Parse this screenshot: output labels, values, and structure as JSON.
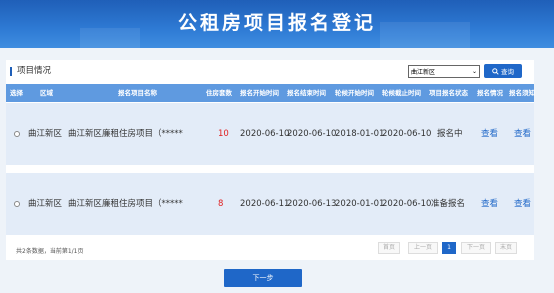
{
  "header": {
    "title": "公租房项目报名登记"
  },
  "section": {
    "title": "项目情况"
  },
  "filter": {
    "district": "曲江新区",
    "search_label": "查询"
  },
  "table": {
    "columns": [
      "选择",
      "区域",
      "报名项目名称",
      "住房套数",
      "报名开始时间",
      "报名结束时间",
      "轮候开始时间",
      "轮候截止时间",
      "项目报名状态",
      "报名情况",
      "报名须知"
    ],
    "rows": [
      {
        "region": "曲江新区",
        "project": "曲江新区廉租住房项目（*****",
        "count": "10",
        "signup_start": "2020-06-10",
        "signup_end": "2020-06-10",
        "wait_start": "2018-01-01",
        "wait_end": "2020-06-10",
        "status": "报名中",
        "view1": "查看",
        "view2": "查看"
      },
      {
        "region": "曲江新区",
        "project": "曲江新区廉租住房项目（*****",
        "count": "8",
        "signup_start": "2020-06-11",
        "signup_end": "2020-06-13",
        "wait_start": "2020-01-01",
        "wait_end": "2020-06-10",
        "status": "准备报名",
        "view1": "查看",
        "view2": "查看"
      }
    ]
  },
  "footer": {
    "summary": "共2条数据，当前第1/1页"
  },
  "pagination": {
    "first": "首页",
    "prev": "上一页",
    "current": "1",
    "next": "下一页",
    "last": "末页"
  },
  "actions": {
    "next_step": "下一步"
  },
  "colors": {
    "primary": "#1f67c8",
    "header_bg": "#5f9ae0",
    "row_bg": "#e3ecf8",
    "count_red": "#e02020"
  }
}
